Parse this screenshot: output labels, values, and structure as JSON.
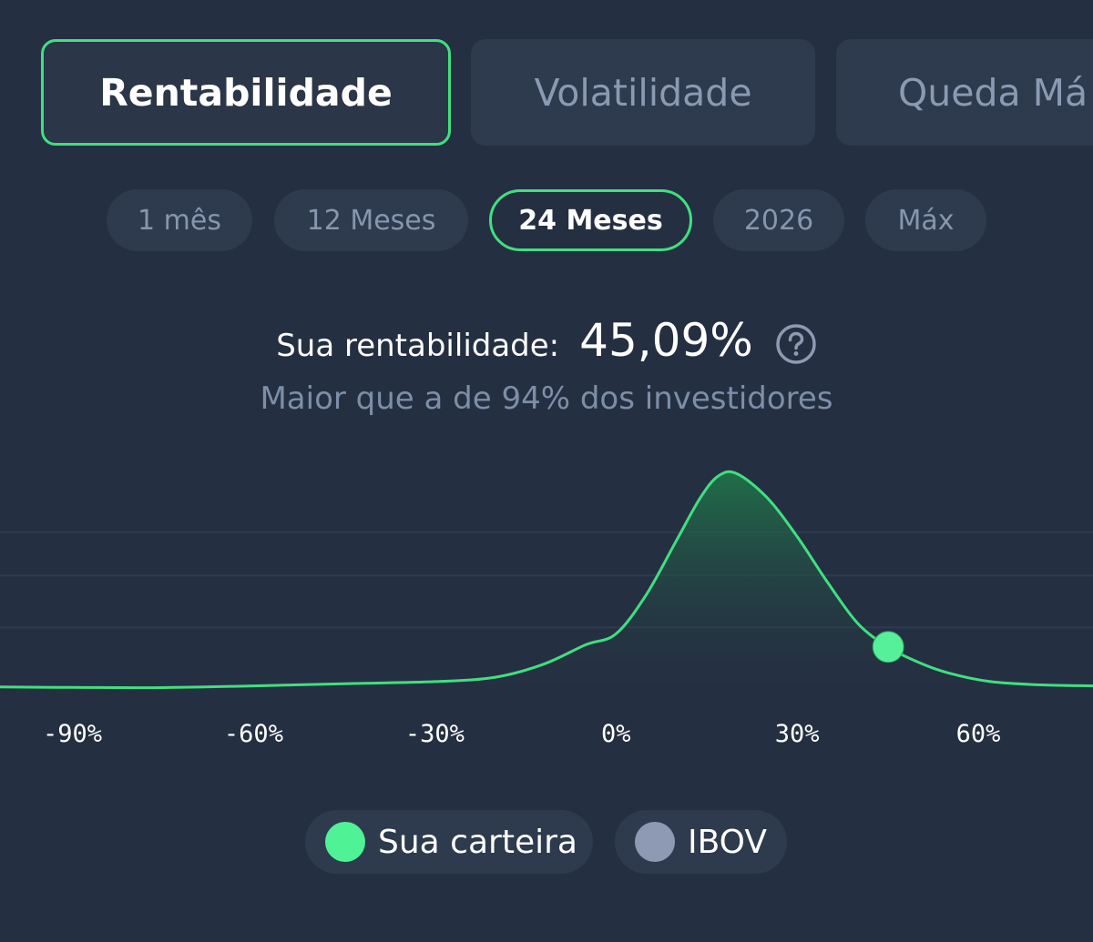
{
  "metric_tabs": [
    {
      "label": "Rentabilidade",
      "active": true
    },
    {
      "label": "Volatilidade",
      "active": false
    },
    {
      "label": "Queda Má",
      "active": false
    }
  ],
  "period_tabs": [
    {
      "label": "1 mês",
      "active": false
    },
    {
      "label": "12 Meses",
      "active": false
    },
    {
      "label": "24 Meses",
      "active": true
    },
    {
      "label": "2026",
      "active": false
    },
    {
      "label": "Máx",
      "active": false
    }
  ],
  "summary": {
    "label": "Sua rentabilidade:",
    "value": "45,09%",
    "comparison": "Maior que a de 94% dos investidores",
    "help_icon": "question-circle-icon"
  },
  "colors": {
    "accent": "#3fe07f",
    "background": "#252f42",
    "chip": "#2e3a4d",
    "muted_text": "#7d8ea8",
    "ibov": "#8e9ab3"
  },
  "chart_data": {
    "type": "area",
    "x_tick_labels": [
      "-90%",
      "-60%",
      "-30%",
      "0%",
      "30%",
      "60%"
    ],
    "x_ticks": [
      -90,
      -60,
      -30,
      0,
      30,
      60
    ],
    "xlim": [
      -102,
      79
    ],
    "ylim": [
      0,
      100
    ],
    "grid": true,
    "series": [
      {
        "name": "Sua carteira",
        "color": "#3fe07f",
        "points": [
          [
            -102,
            0.5
          ],
          [
            -90,
            0.3
          ],
          [
            -75,
            0.2
          ],
          [
            -60,
            1.0
          ],
          [
            -45,
            2.0
          ],
          [
            -30,
            3.0
          ],
          [
            -20,
            5.0
          ],
          [
            -12,
            11.0
          ],
          [
            -5,
            20.0
          ],
          [
            0,
            25.0
          ],
          [
            5,
            43.0
          ],
          [
            10,
            68.0
          ],
          [
            14,
            88.0
          ],
          [
            17,
            98.0
          ],
          [
            20,
            99.0
          ],
          [
            25,
            88.0
          ],
          [
            30,
            70.0
          ],
          [
            35,
            49.0
          ],
          [
            40,
            30.0
          ],
          [
            45,
            19.0
          ],
          [
            50,
            12.0
          ],
          [
            55,
            7.0
          ],
          [
            62,
            3.0
          ],
          [
            70,
            1.5
          ],
          [
            79,
            1.0
          ]
        ]
      }
    ],
    "marker": {
      "x": 45.09,
      "y": 19.0,
      "label": "45,09%"
    },
    "legend": [
      {
        "label": "Sua carteira",
        "color": "#3fe07f",
        "icon": "green-dot-icon"
      },
      {
        "label": "IBOV",
        "color": "#8e9ab3",
        "icon": "gray-dot-icon"
      }
    ]
  }
}
